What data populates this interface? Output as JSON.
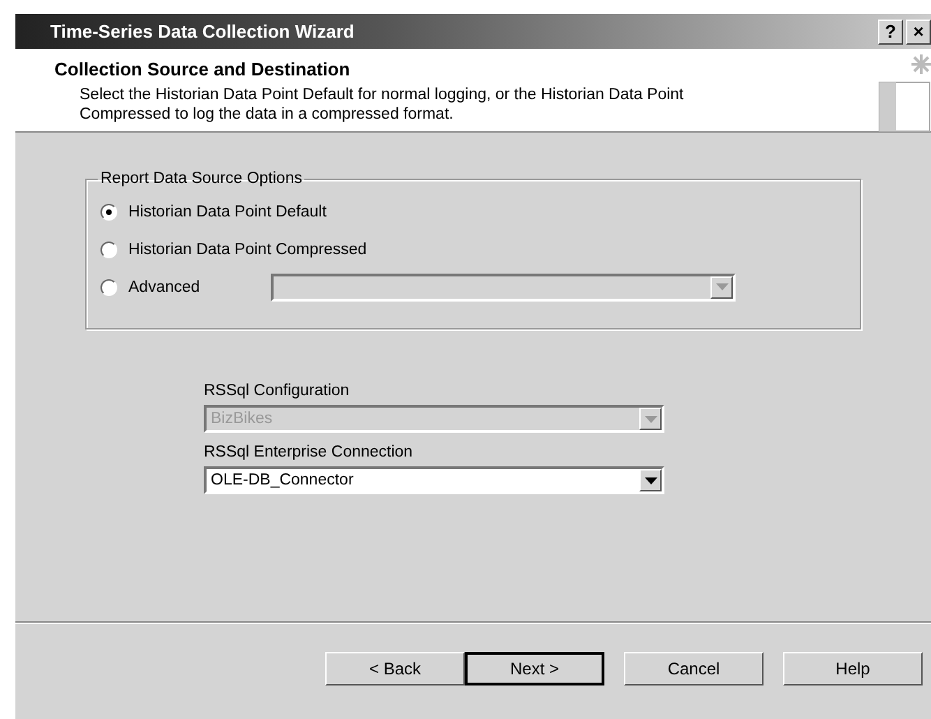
{
  "window": {
    "title": "Time-Series Data Collection Wizard",
    "title_buttons": [
      "?",
      "×"
    ]
  },
  "header": {
    "title": "Collection Source and Destination",
    "description": "Select the Historian Data Point Default for normal logging, or the Historian Data Point Compressed to log the data in a compressed format."
  },
  "group": {
    "label": "Report Data Source Options",
    "options": [
      {
        "label": "Historian Data Point Default",
        "selected": true
      },
      {
        "label": "Historian Data Point Compressed",
        "selected": false
      },
      {
        "label": "Advanced",
        "selected": false,
        "has_combo": true
      }
    ]
  },
  "fields": [
    {
      "label": "RSSql Configuration",
      "value": "BizBikes",
      "disabled": true
    },
    {
      "label": "RSSql Enterprise Connection",
      "value": "OLE-DB_Connector",
      "disabled": false
    }
  ],
  "buttons": [
    {
      "label": "< Back",
      "default": false
    },
    {
      "label": "Next >",
      "default": true
    },
    {
      "label": "Cancel",
      "default": false
    },
    {
      "label": "Help",
      "default": false
    }
  ]
}
